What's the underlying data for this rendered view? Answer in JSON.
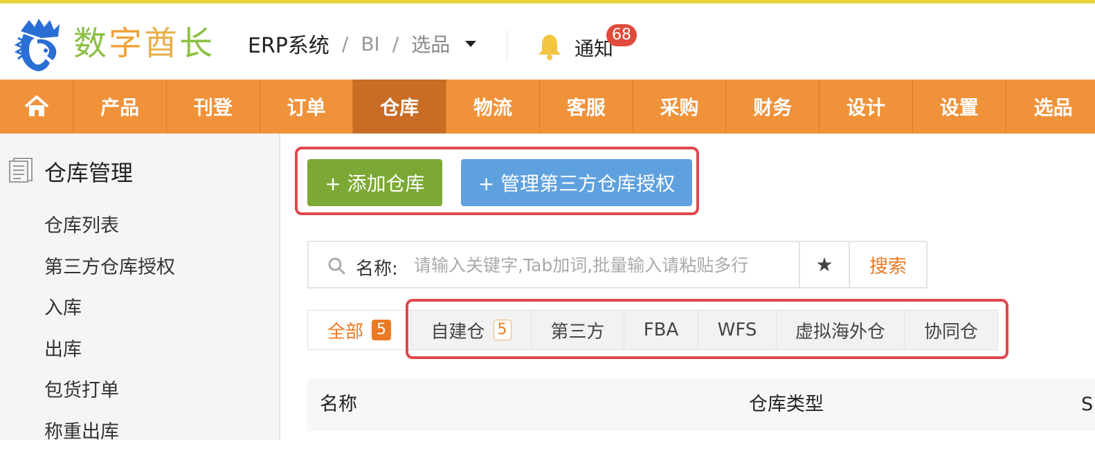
{
  "header": {
    "brand_chars": [
      "数",
      "字",
      "酋",
      "长"
    ],
    "breadcrumb": {
      "system": "ERP系统",
      "sep": "/",
      "section": "BI",
      "current": "选品"
    },
    "notify_label": "通知",
    "notify_count": "68"
  },
  "nav": {
    "items": [
      "产品",
      "刊登",
      "订单",
      "仓库",
      "物流",
      "客服",
      "采购",
      "财务",
      "设计",
      "设置",
      "选品"
    ],
    "active": "仓库"
  },
  "sidebar": {
    "title": "仓库管理",
    "items": [
      "仓库列表",
      "第三方仓库授权",
      "入库",
      "出库",
      "包货打单",
      "称重出库"
    ]
  },
  "actions": {
    "add_label": "+ 添加仓库",
    "auth_label": "+ 管理第三方仓库授权"
  },
  "search": {
    "label": "名称:",
    "placeholder": "请输入关键字,Tab加词,批量输入请粘贴多行",
    "star": "★",
    "button": "搜索"
  },
  "tabs": {
    "all": {
      "label": "全部",
      "count": "5"
    },
    "items": [
      {
        "label": "自建仓",
        "count": "5"
      },
      {
        "label": "第三方"
      },
      {
        "label": "FBA"
      },
      {
        "label": "WFS"
      },
      {
        "label": "虚拟海外仓"
      },
      {
        "label": "协同仓"
      }
    ]
  },
  "table": {
    "columns": [
      "名称",
      "仓库类型",
      "S"
    ]
  },
  "colors": {
    "nav_bg": "#f0923a",
    "nav_active": "#c96c25",
    "accent": "#ea7a25",
    "btn_green": "#7ca935",
    "btn_blue": "#5fa1df",
    "highlight": "#e0474c"
  }
}
